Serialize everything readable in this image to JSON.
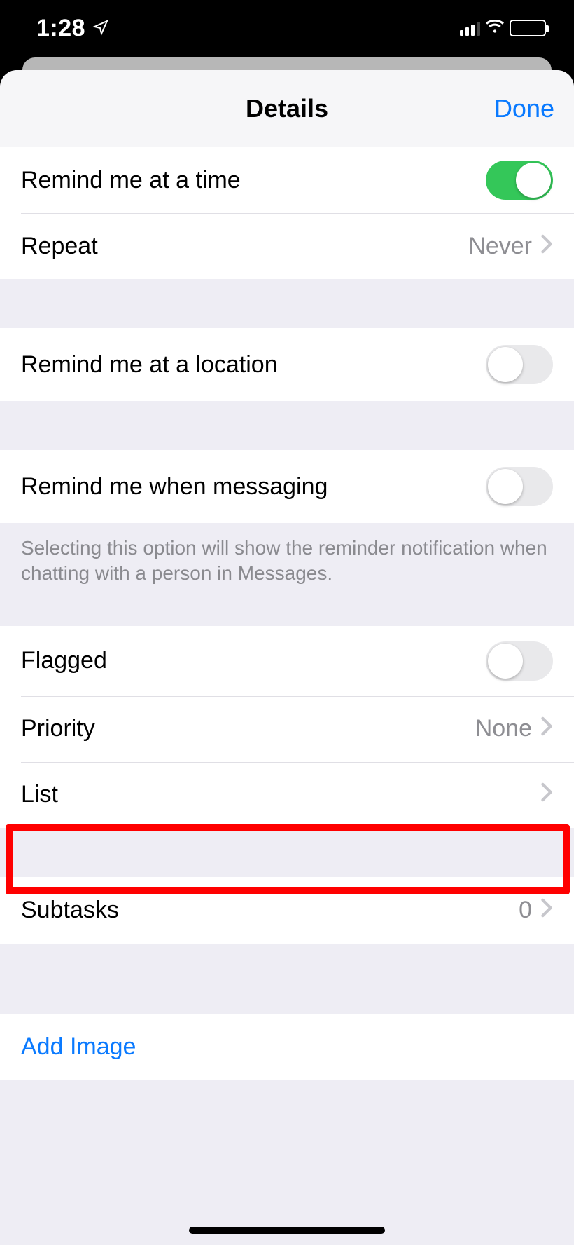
{
  "status": {
    "time": "1:28"
  },
  "nav": {
    "title": "Details",
    "done": "Done"
  },
  "rows": {
    "remind_time": {
      "label": "Remind me at a time",
      "on": true
    },
    "repeat": {
      "label": "Repeat",
      "value": "Never"
    },
    "remind_location": {
      "label": "Remind me at a location",
      "on": false
    },
    "remind_messaging": {
      "label": "Remind me when messaging",
      "on": false
    },
    "messaging_footnote": "Selecting this option will show the reminder notification when chatting with a person in Messages.",
    "flagged": {
      "label": "Flagged",
      "on": false
    },
    "priority": {
      "label": "Priority",
      "value": "None"
    },
    "list": {
      "label": "List",
      "value": ""
    },
    "subtasks": {
      "label": "Subtasks",
      "value": "0"
    },
    "add_image": {
      "label": "Add Image"
    }
  }
}
